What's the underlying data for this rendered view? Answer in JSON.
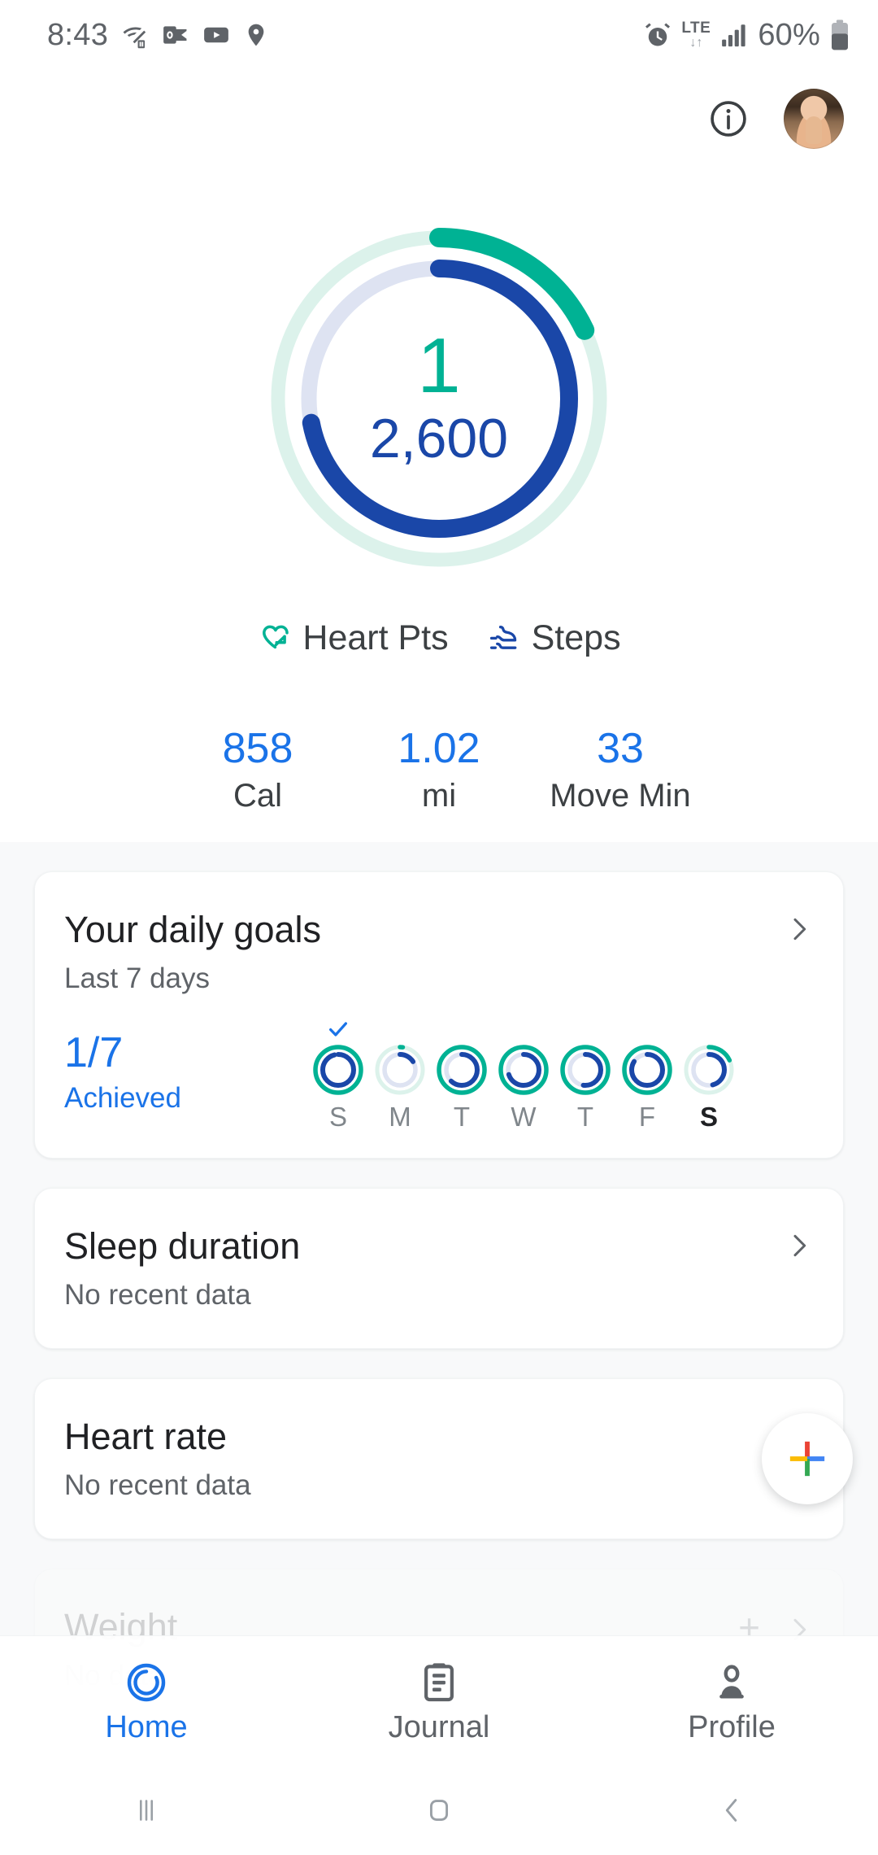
{
  "status_bar": {
    "time": "8:43",
    "battery_percent": "60%",
    "network_type": "LTE",
    "left_icons": [
      "wifi-icon",
      "outlook-icon",
      "youtube-icon",
      "location-pin-icon"
    ],
    "right_icons": [
      "alarm-icon",
      "lte-data-icon",
      "signal-bars-icon",
      "battery-icon"
    ]
  },
  "header": {
    "info_icon": "info-icon",
    "avatar": "user-avatar"
  },
  "main_ring": {
    "heart_points": "1",
    "steps": "2,600",
    "heart_points_color": "#00B294",
    "steps_color": "#1A47A8",
    "heart_track_color": "#DCF2EB",
    "steps_track_color": "#DEE3F2",
    "heart_percent": 18,
    "steps_percent": 72
  },
  "legend": [
    {
      "label": "Heart Pts",
      "icon": "heart-arrow-icon",
      "color": "#00B294"
    },
    {
      "label": "Steps",
      "icon": "shoe-icon",
      "color": "#1A47A8"
    }
  ],
  "stats": [
    {
      "value": "858",
      "label": "Cal"
    },
    {
      "value": "1.02",
      "label": "mi"
    },
    {
      "value": "33",
      "label": "Move Min"
    }
  ],
  "cards": {
    "daily_goals": {
      "title": "Your daily goals",
      "subtitle": "Last 7 days",
      "achieved_fraction": "1/7",
      "achieved_label": "Achieved",
      "chevron": "chevron-right-icon",
      "days": [
        {
          "label": "S",
          "heart_percent": 100,
          "steps_percent": 96,
          "achieved": true,
          "today": false
        },
        {
          "label": "M",
          "heart_percent": 2,
          "steps_percent": 16,
          "achieved": false,
          "today": false
        },
        {
          "label": "T",
          "heart_percent": 100,
          "steps_percent": 62,
          "achieved": false,
          "today": false
        },
        {
          "label": "W",
          "heart_percent": 100,
          "steps_percent": 70,
          "achieved": false,
          "today": false
        },
        {
          "label": "T",
          "heart_percent": 100,
          "steps_percent": 52,
          "achieved": false,
          "today": false
        },
        {
          "label": "F",
          "heart_percent": 100,
          "steps_percent": 84,
          "achieved": false,
          "today": false
        },
        {
          "label": "S",
          "heart_percent": 18,
          "steps_percent": 46,
          "achieved": false,
          "today": true
        }
      ]
    },
    "sleep": {
      "title": "Sleep duration",
      "subtitle": "No recent data",
      "chevron": "chevron-right-icon"
    },
    "heart_rate": {
      "title": "Heart rate",
      "subtitle": "No recent data",
      "fab_icon": "google-plus-add-icon"
    },
    "weight": {
      "title": "Weight",
      "subtitle": "No data",
      "add_icon": "plus-icon",
      "chevron": "chevron-right-icon"
    }
  },
  "bottom_nav": [
    {
      "label": "Home",
      "icon": "fit-rings-icon",
      "active": true
    },
    {
      "label": "Journal",
      "icon": "clipboard-icon",
      "active": false
    },
    {
      "label": "Profile",
      "icon": "person-icon",
      "active": false
    }
  ],
  "system_nav": [
    {
      "icon": "recents-icon"
    },
    {
      "icon": "home-square-icon"
    },
    {
      "icon": "back-chevron-icon"
    }
  ]
}
